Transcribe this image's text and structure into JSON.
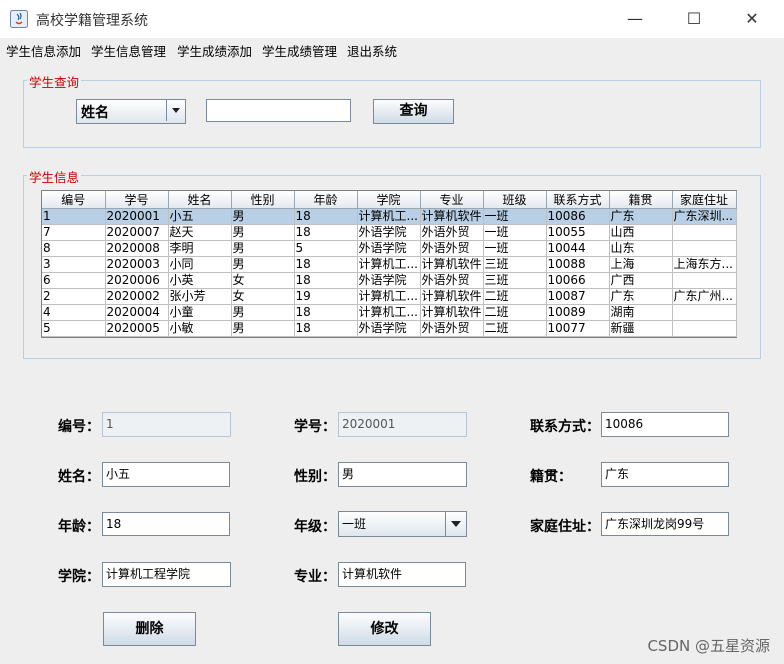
{
  "window": {
    "title": "高校学籍管理系统"
  },
  "menu": [
    "学生信息添加",
    "学生信息管理",
    "学生成绩添加",
    "学生成绩管理",
    "退出系统"
  ],
  "query": {
    "legend": "学生查询",
    "field_selected": "姓名",
    "input_value": "",
    "button": "查询"
  },
  "info": {
    "legend": "学生信息",
    "columns": [
      "编号",
      "学号",
      "姓名",
      "性别",
      "年龄",
      "学院",
      "专业",
      "班级",
      "联系方式",
      "籍贯",
      "家庭住址"
    ],
    "rows": [
      [
        "1",
        "2020001",
        "小五",
        "男",
        "18",
        "计算机工...",
        "计算机软件",
        "一班",
        "10086",
        "广东",
        "广东深圳..."
      ],
      [
        "7",
        "2020007",
        "赵天",
        "男",
        "18",
        "外语学院",
        "外语外贸",
        "一班",
        "10055",
        "山西",
        ""
      ],
      [
        "8",
        "2020008",
        "李明",
        "男",
        "5",
        "外语学院",
        "外语外贸",
        "一班",
        "10044",
        "山东",
        ""
      ],
      [
        "3",
        "2020003",
        "小同",
        "男",
        "18",
        "计算机工...",
        "计算机软件",
        "三班",
        "10088",
        "上海",
        "上海东方..."
      ],
      [
        "6",
        "2020006",
        "小英",
        "女",
        "18",
        "外语学院",
        "外语外贸",
        "三班",
        "10066",
        "广西",
        ""
      ],
      [
        "2",
        "2020002",
        "张小芳",
        "女",
        "19",
        "计算机工...",
        "计算机软件",
        "二班",
        "10087",
        "广东",
        "广东广州..."
      ],
      [
        "4",
        "2020004",
        "小童",
        "男",
        "18",
        "计算机工...",
        "计算机软件",
        "二班",
        "10089",
        "湖南",
        ""
      ],
      [
        "5",
        "2020005",
        "小敏",
        "男",
        "18",
        "外语学院",
        "外语外贸",
        "二班",
        "10077",
        "新疆",
        ""
      ]
    ]
  },
  "form": {
    "id_label": "编号：",
    "id_value": "1",
    "sno_label": "学号：",
    "sno_value": "2020001",
    "phone_label": "联系方式：",
    "phone_value": "10086",
    "name_label": "姓名：",
    "name_value": "小五",
    "gender_label": "性别：",
    "gender_value": "男",
    "native_label": "籍贯：",
    "native_value": "广东",
    "age_label": "年龄：",
    "age_value": "18",
    "grade_label": "年级：",
    "grade_value": "一班",
    "address_label": "家庭住址：",
    "address_value": "广东深圳龙岗99号",
    "college_label": "学院：",
    "college_value": "计算机工程学院",
    "major_label": "专业：",
    "major_value": "计算机软件",
    "delete_button": "删除",
    "modify_button": "修改"
  },
  "watermark": "CSDN @五星资源"
}
